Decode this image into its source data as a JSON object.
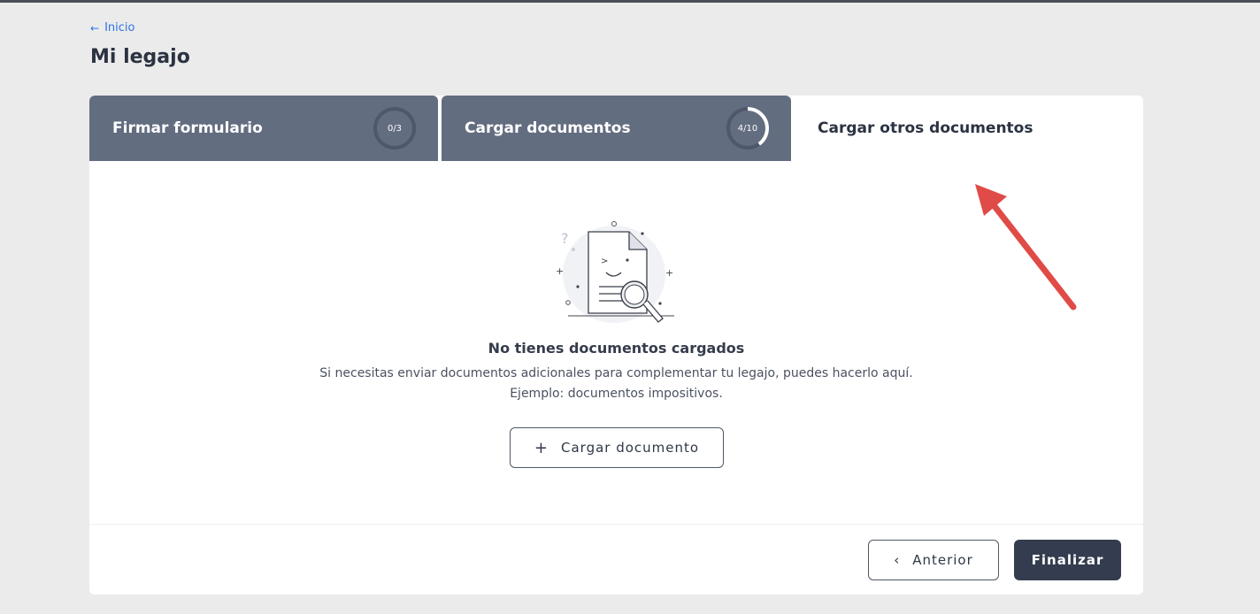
{
  "nav": {
    "back_label": "Inicio",
    "back_icon": "arrow-left-icon"
  },
  "page": {
    "title": "Mi legajo"
  },
  "tabs": [
    {
      "label": "Firmar formulario",
      "progress_text": "0/3",
      "progress": 0.0,
      "state": "inactive"
    },
    {
      "label": "Cargar documentos",
      "progress_text": "4/10",
      "progress": 0.4,
      "state": "inactive"
    },
    {
      "label": "Cargar otros documentos",
      "state": "active"
    }
  ],
  "empty_state": {
    "illustration": "document-search-illustration",
    "title": "No tienes documentos cargados",
    "description_line1": "Si necesitas enviar documentos adicionales para complementar tu legajo, puedes hacerlo aquí.",
    "description_line2": "Ejemplo: documentos impositivos.",
    "upload_button": {
      "icon": "plus-icon",
      "label": "Cargar documento"
    }
  },
  "footer": {
    "prev_button": {
      "icon": "chevron-left-icon",
      "label": "Anterior"
    },
    "finish_button": {
      "label": "Finalizar"
    }
  },
  "colors": {
    "tab_inactive": "#636d80",
    "primary_dark": "#343d4f",
    "link": "#2f74e0",
    "annotation_arrow": "#e04b47"
  }
}
